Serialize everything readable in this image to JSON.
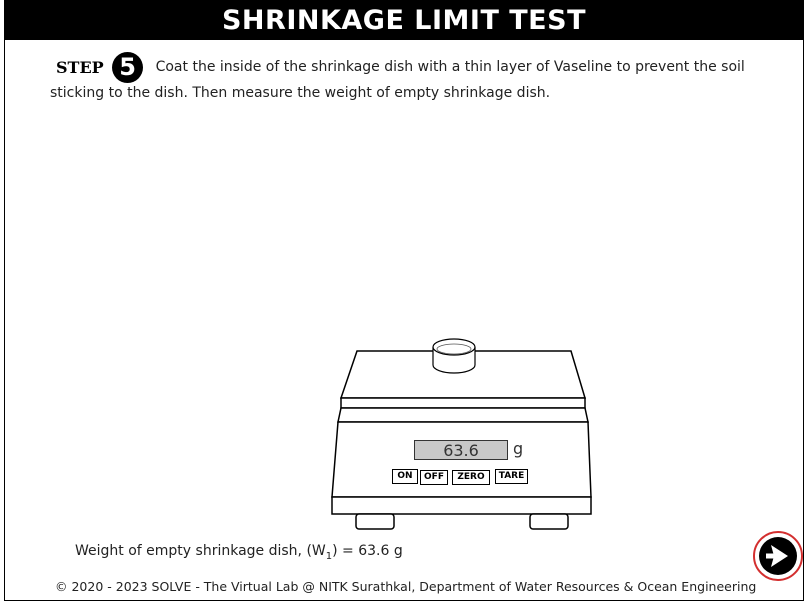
{
  "header": {
    "title": "SHRINKAGE LIMIT TEST"
  },
  "step": {
    "label": "STEP",
    "number": "5",
    "instruction": "Coat the inside of the shrinkage dish with a thin layer of Vaseline to prevent the soil sticking to the dish. Then measure the weight of empty shrinkage dish."
  },
  "scale": {
    "display_value": "63.6",
    "unit": "g",
    "buttons": {
      "on": "ON",
      "off": "OFF",
      "zero": "ZERO",
      "tare": "TARE"
    }
  },
  "result": {
    "prefix": "Weight of empty shrinkage dish, (W",
    "subscript": "1",
    "suffix": ") = 63.6 g"
  },
  "footer": {
    "text": "© 2020 - 2023 SOLVE - The Virtual Lab @ NITK Surathkal, Department of Water Resources & Ocean Engineering"
  },
  "navigation": {
    "next_icon": "next-arrow-icon",
    "accent_color": "#d32f2f"
  }
}
